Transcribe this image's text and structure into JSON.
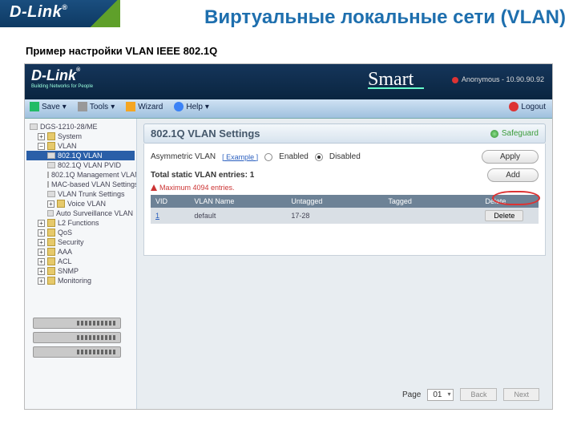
{
  "slide": {
    "brand": "D-Link",
    "title": "Виртуальные локальные сети (VLAN)",
    "subtitle": "Пример настройки VLAN IEEE 802.1Q"
  },
  "app": {
    "logo": "D-Link",
    "logo_sub": "Building Networks for People",
    "smart": "Smart",
    "user_label": "Anonymous - 10.90.90.92",
    "menubar": {
      "save": "Save",
      "tools": "Tools",
      "wizard": "Wizard",
      "help": "Help",
      "logout": "Logout"
    },
    "tree": {
      "root": "DGS-1210-28/ME",
      "n1": "System",
      "n2": "VLAN",
      "n2a": "802.1Q VLAN",
      "n2b": "802.1Q VLAN PVID",
      "n2c": "802.1Q Management VLAN",
      "n2d": "MAC-based VLAN Settings",
      "n2e": "VLAN Trunk Settings",
      "n2f": "Voice VLAN",
      "n2g": "Auto Surveillance VLAN",
      "n3": "L2 Functions",
      "n4": "QoS",
      "n5": "Security",
      "n6": "AAA",
      "n7": "ACL",
      "n8": "SNMP",
      "n9": "Monitoring"
    }
  },
  "panel": {
    "title": "802.1Q VLAN Settings",
    "safeguard": "Safeguard",
    "asym_label": "Asymmetric VLAN",
    "example_link": "[ Example ]",
    "enabled": "Enabled",
    "disabled": "Disabled",
    "apply": "Apply",
    "total_label": "Total static VLAN entries:",
    "total_value": "1",
    "note": "Maximum 4094 entries.",
    "add": "Add",
    "cols": {
      "vid": "VID",
      "name": "VLAN Name",
      "untagged": "Untagged",
      "tagged": "Tagged",
      "del": "Delete"
    },
    "rows": [
      {
        "vid": "1",
        "name": "default",
        "untagged": "17-28",
        "tagged": ""
      }
    ],
    "delete_btn": "Delete",
    "pager": {
      "page_label": "Page",
      "page_value": "01",
      "back": "Back",
      "next": "Next"
    }
  }
}
